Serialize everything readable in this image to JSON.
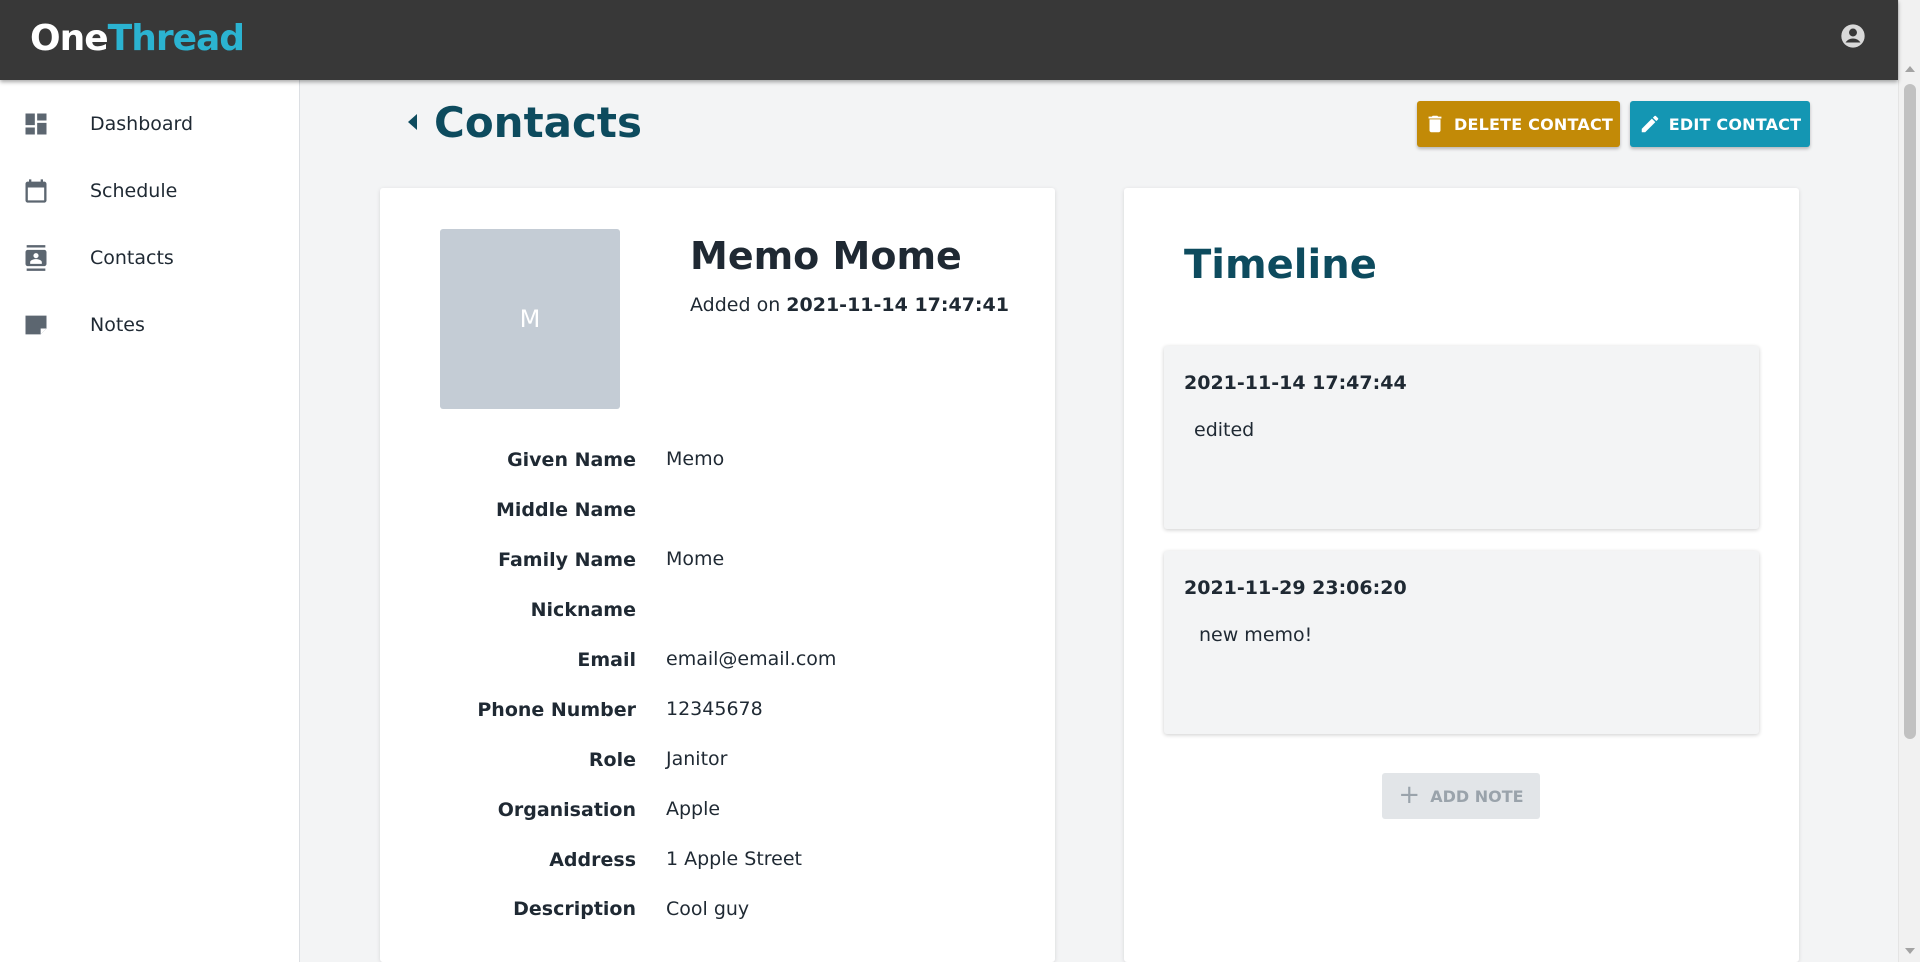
{
  "app": {
    "logo_part1": "One",
    "logo_part2": "Thread",
    "brand_color": "#2bb3d1",
    "account_icon": "account-circle-icon"
  },
  "sidebar": {
    "items": [
      {
        "label": "Dashboard",
        "icon": "dashboard-icon"
      },
      {
        "label": "Schedule",
        "icon": "calendar-icon"
      },
      {
        "label": "Contacts",
        "icon": "contact-card-icon"
      },
      {
        "label": "Notes",
        "icon": "note-icon"
      }
    ]
  },
  "page": {
    "title": "Contacts",
    "title_color": "#0d4b5e",
    "delete_label": "DELETE CONTACT",
    "delete_color": "#c28a07",
    "edit_label": "EDIT CONTACT",
    "edit_color": "#1496b3"
  },
  "contact": {
    "avatar_initial": "M",
    "name": "Memo Mome",
    "added_prefix": "Added on",
    "added_timestamp": "2021-11-14 17:47:41",
    "fields": [
      {
        "label": "Given Name",
        "value": "Memo"
      },
      {
        "label": "Middle Name",
        "value": ""
      },
      {
        "label": "Family Name",
        "value": "Mome"
      },
      {
        "label": "Nickname",
        "value": ""
      },
      {
        "label": "Email",
        "value": "email@email.com"
      },
      {
        "label": "Phone Number",
        "value": "12345678"
      },
      {
        "label": "Role",
        "value": "Janitor"
      },
      {
        "label": "Organisation",
        "value": "Apple"
      },
      {
        "label": "Address",
        "value": "1 Apple Street"
      },
      {
        "label": "Description",
        "value": "Cool guy"
      }
    ]
  },
  "timeline": {
    "title": "Timeline",
    "notes": [
      {
        "date": "2021-11-14 17:47:44",
        "text": "edited"
      },
      {
        "date": "2021-11-29 23:06:20",
        "text": "new memo!"
      }
    ],
    "add_note_label": "ADD NOTE"
  }
}
